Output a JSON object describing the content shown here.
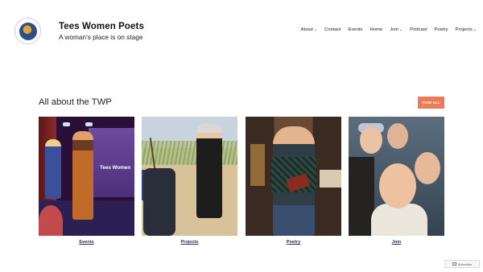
{
  "site": {
    "title": "Tees Women Poets",
    "tagline": "A woman's place is on stage"
  },
  "nav": [
    {
      "label": "About",
      "dropdown": true
    },
    {
      "label": "Contact",
      "dropdown": false
    },
    {
      "label": "Events",
      "dropdown": false
    },
    {
      "label": "Home",
      "dropdown": false
    },
    {
      "label": "Join",
      "dropdown": true
    },
    {
      "label": "Podcast",
      "dropdown": false
    },
    {
      "label": "Poetry",
      "dropdown": false
    },
    {
      "label": "Projects",
      "dropdown": true
    }
  ],
  "section": {
    "title": "All about the TWP",
    "view_all": "VIEW ALL"
  },
  "cards": [
    {
      "label": "Events",
      "image_text": "Tees Women"
    },
    {
      "label": "Projects"
    },
    {
      "label": "Poetry"
    },
    {
      "label": "Join"
    }
  ],
  "footer": {
    "subscribe": "Subscribe"
  },
  "colors": {
    "accent": "#ee7b58",
    "link": "#3a2a55"
  }
}
